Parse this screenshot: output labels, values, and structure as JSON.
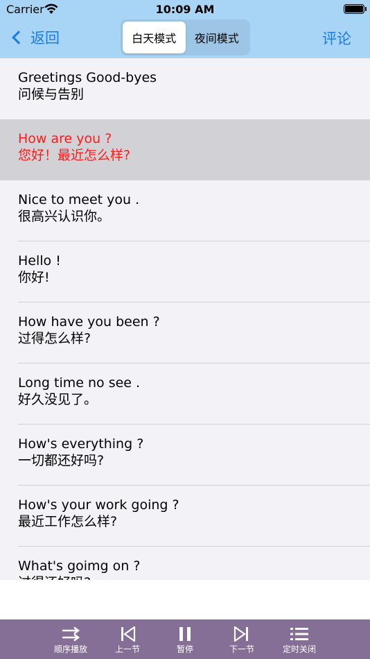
{
  "status": {
    "carrier": "Carrier",
    "time": "10:09 AM"
  },
  "nav": {
    "back_label": "返回",
    "segments": [
      {
        "label": "白天模式",
        "active": true
      },
      {
        "label": "夜间模式",
        "active": false
      }
    ],
    "comment_label": "评论"
  },
  "colors": {
    "header_bg": "#a8d4f5",
    "accent": "#1a7ce6",
    "highlight_text": "#ff1a1a",
    "player_bar_bg": "#856f96"
  },
  "lessons": [
    {
      "en": "Greetings  Good-byes",
      "zh": "问候与告别"
    },
    {
      "en": "How are you ?",
      "zh": "您好！最近怎么样?",
      "highlighted": true
    },
    {
      "en": "Nice to meet you .",
      "zh": "很高兴认识你。"
    },
    {
      "en": "Hello !",
      "zh": "你好!"
    },
    {
      "en": "How have you been ?",
      "zh": "过得怎么样?"
    },
    {
      "en": "Long time no see .",
      "zh": "好久没见了。"
    },
    {
      "en": "How's everything ?",
      "zh": "一切都还好吗?"
    },
    {
      "en": "How's your work going ?",
      "zh": "最近工作怎么样?"
    },
    {
      "en": "What's goimg on ?",
      "zh": "过得还好吗?"
    }
  ],
  "player": {
    "controls": [
      {
        "label": "顺序播放",
        "icon": "shuffle-icon"
      },
      {
        "label": "上一节",
        "icon": "skip-back-icon"
      },
      {
        "label": "暂停",
        "icon": "pause-icon"
      },
      {
        "label": "下一节",
        "icon": "skip-forward-icon"
      },
      {
        "label": "定时关闭",
        "icon": "list-timer-icon"
      }
    ]
  }
}
